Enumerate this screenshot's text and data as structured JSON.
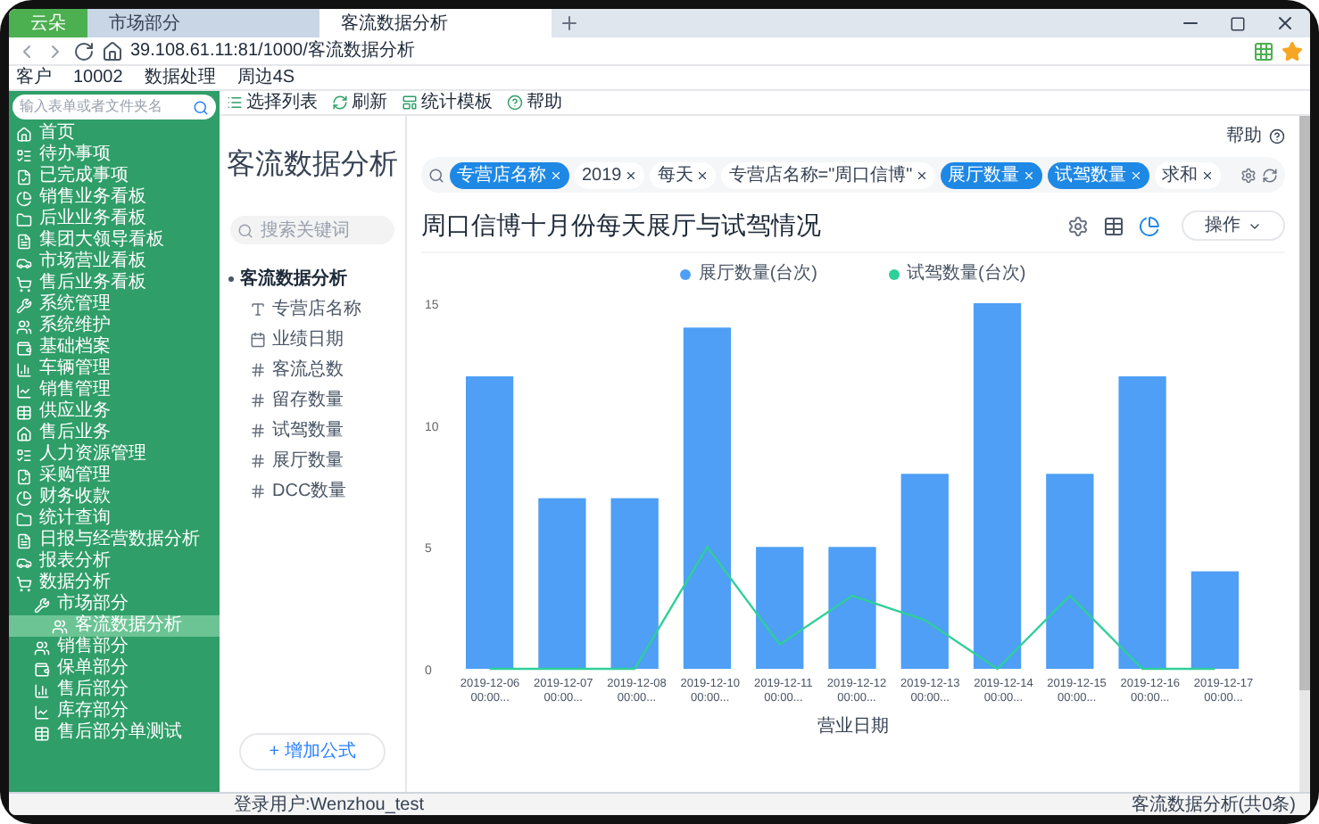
{
  "browser": {
    "menu_button": "云朵",
    "tabs": [
      {
        "label": "市场部分",
        "selected": false
      },
      {
        "label": "客流数据分析",
        "selected": true
      }
    ],
    "address": "39.108.61.11:81/1000/客流数据分析",
    "bookmarks": [
      "客户",
      "10002",
      "数据处理",
      "周边4S"
    ]
  },
  "sidebar": {
    "search": {
      "placeholder": "输入表单或者文件夹名"
    },
    "items": [
      {
        "label": "首页",
        "selected": false
      },
      {
        "label": "待办事项",
        "selected": false
      },
      {
        "label": "已完成事项",
        "selected": false
      },
      {
        "label": "销售业务看板",
        "selected": false
      },
      {
        "label": "后业业务看板",
        "selected": false
      },
      {
        "label": "集团大领导看板",
        "selected": false
      },
      {
        "label": "市场营业看板",
        "selected": false
      },
      {
        "label": "售后业务看板",
        "selected": false
      },
      {
        "label": "系统管理",
        "selected": false
      },
      {
        "label": "系统维护",
        "selected": false
      },
      {
        "label": "基础档案",
        "selected": false
      },
      {
        "label": "车辆管理",
        "selected": false
      },
      {
        "label": "销售管理",
        "selected": false
      },
      {
        "label": "供应业务",
        "selected": false
      },
      {
        "label": "售后业务",
        "selected": false
      },
      {
        "label": "人力资源管理",
        "selected": false
      },
      {
        "label": "采购管理",
        "selected": false
      },
      {
        "label": "财务收款",
        "selected": false
      },
      {
        "label": "统计查询",
        "selected": false
      },
      {
        "label": "日报与经营数据分析",
        "selected": false
      },
      {
        "label": "报表分析",
        "selected": false
      },
      {
        "label": "数据分析",
        "selected": false,
        "children": [
          {
            "label": "市场部分",
            "selected": false,
            "children": [
              {
                "label": "客流数据分析",
                "selected": true
              }
            ]
          },
          {
            "label": "销售部分",
            "selected": false
          },
          {
            "label": "保单部分",
            "selected": false
          },
          {
            "label": "售后部分",
            "selected": false
          },
          {
            "label": "库存部分",
            "selected": false
          },
          {
            "label": "售后部分单测试",
            "selected": false
          }
        ]
      }
    ]
  },
  "toolbar": [
    "选择列表",
    "刷新",
    "统计模板",
    "帮助"
  ],
  "fields_panel": {
    "title": "客流数据分析",
    "search": {
      "placeholder": "搜索关键词"
    },
    "group": "客流数据分析",
    "fields": [
      {
        "label": "专营店名称",
        "kind": "text"
      },
      {
        "label": "业绩日期",
        "kind": "date"
      },
      {
        "label": "客流总数",
        "kind": "number"
      },
      {
        "label": "留存数量",
        "kind": "number"
      },
      {
        "label": "试驾数量",
        "kind": "number"
      },
      {
        "label": "展厅数量",
        "kind": "number"
      },
      {
        "label": "DCC数量",
        "kind": "number"
      }
    ],
    "add_button": "+ 增加公式"
  },
  "main": {
    "help": "帮助",
    "filters": [
      {
        "label": "专营店名称",
        "selected": true
      },
      {
        "label": "2019",
        "selected": false
      },
      {
        "label": "每天",
        "selected": false
      },
      {
        "label": "专营店名称=\"周口信博\"",
        "selected": false
      },
      {
        "label": "展厅数量",
        "selected": true
      },
      {
        "label": "试驾数量",
        "selected": true
      },
      {
        "label": "求和",
        "selected": false
      }
    ],
    "title": "周口信博十月份每天展厅与试驾情况",
    "action_button": "操作",
    "chart_data": {
      "type": "bar",
      "xlabel": "营业日期",
      "categories": [
        "2019-12-06 00:00...",
        "2019-12-07 00:00...",
        "2019-12-08 00:00...",
        "2019-12-10 00:00...",
        "2019-12-11 00:00...",
        "2019-12-12 00:00...",
        "2019-12-13 00:00...",
        "2019-12-14 00:00...",
        "2019-12-15 00:00...",
        "2019-12-16 00:00...",
        "2019-12-17 00:00..."
      ],
      "legend": "top",
      "series": [
        {
          "name": "展厅数量(台次)",
          "color": "#4e9ff5",
          "values": [
            12,
            7,
            7,
            14,
            5,
            5,
            8,
            15,
            8,
            12,
            4
          ]
        },
        {
          "name": "试驾数量(台次)",
          "type": "line",
          "color": "#2fcf9a",
          "values": [
            0,
            0,
            0,
            5,
            1,
            3,
            2,
            0,
            3,
            0,
            0
          ]
        }
      ],
      "ylim": [
        0,
        15
      ],
      "yticks": [
        0,
        5,
        10,
        15
      ]
    }
  },
  "status_bar": {
    "left": "登录用户:Wenzhou_test",
    "right": "客流数据分析(共0条)"
  }
}
